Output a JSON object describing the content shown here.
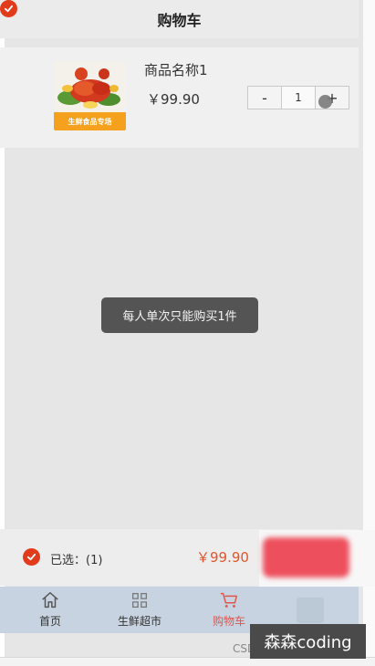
{
  "header": {
    "title": "购物车"
  },
  "cart_item": {
    "name": "商品名称1",
    "price": "￥99.90",
    "thumb_banner": "生鲜食品专场",
    "quantity": "1",
    "minus_label": "-",
    "plus_label": "+",
    "checked": true
  },
  "toast": {
    "message": "每人单次只能购买1件"
  },
  "cart_bar": {
    "selected_label": "已选：(1)",
    "total": "￥99.90",
    "accent_color": "#e23b1b",
    "checkout_color": "#ee4f5d"
  },
  "tabs": [
    {
      "label": "首页",
      "icon": "home-icon"
    },
    {
      "label": "生鲜超市",
      "icon": "grocery-icon"
    },
    {
      "label": "购物车",
      "icon": "cart-icon",
      "active": true
    }
  ],
  "watermark": {
    "text": "森森coding",
    "sub": "CSDN"
  }
}
